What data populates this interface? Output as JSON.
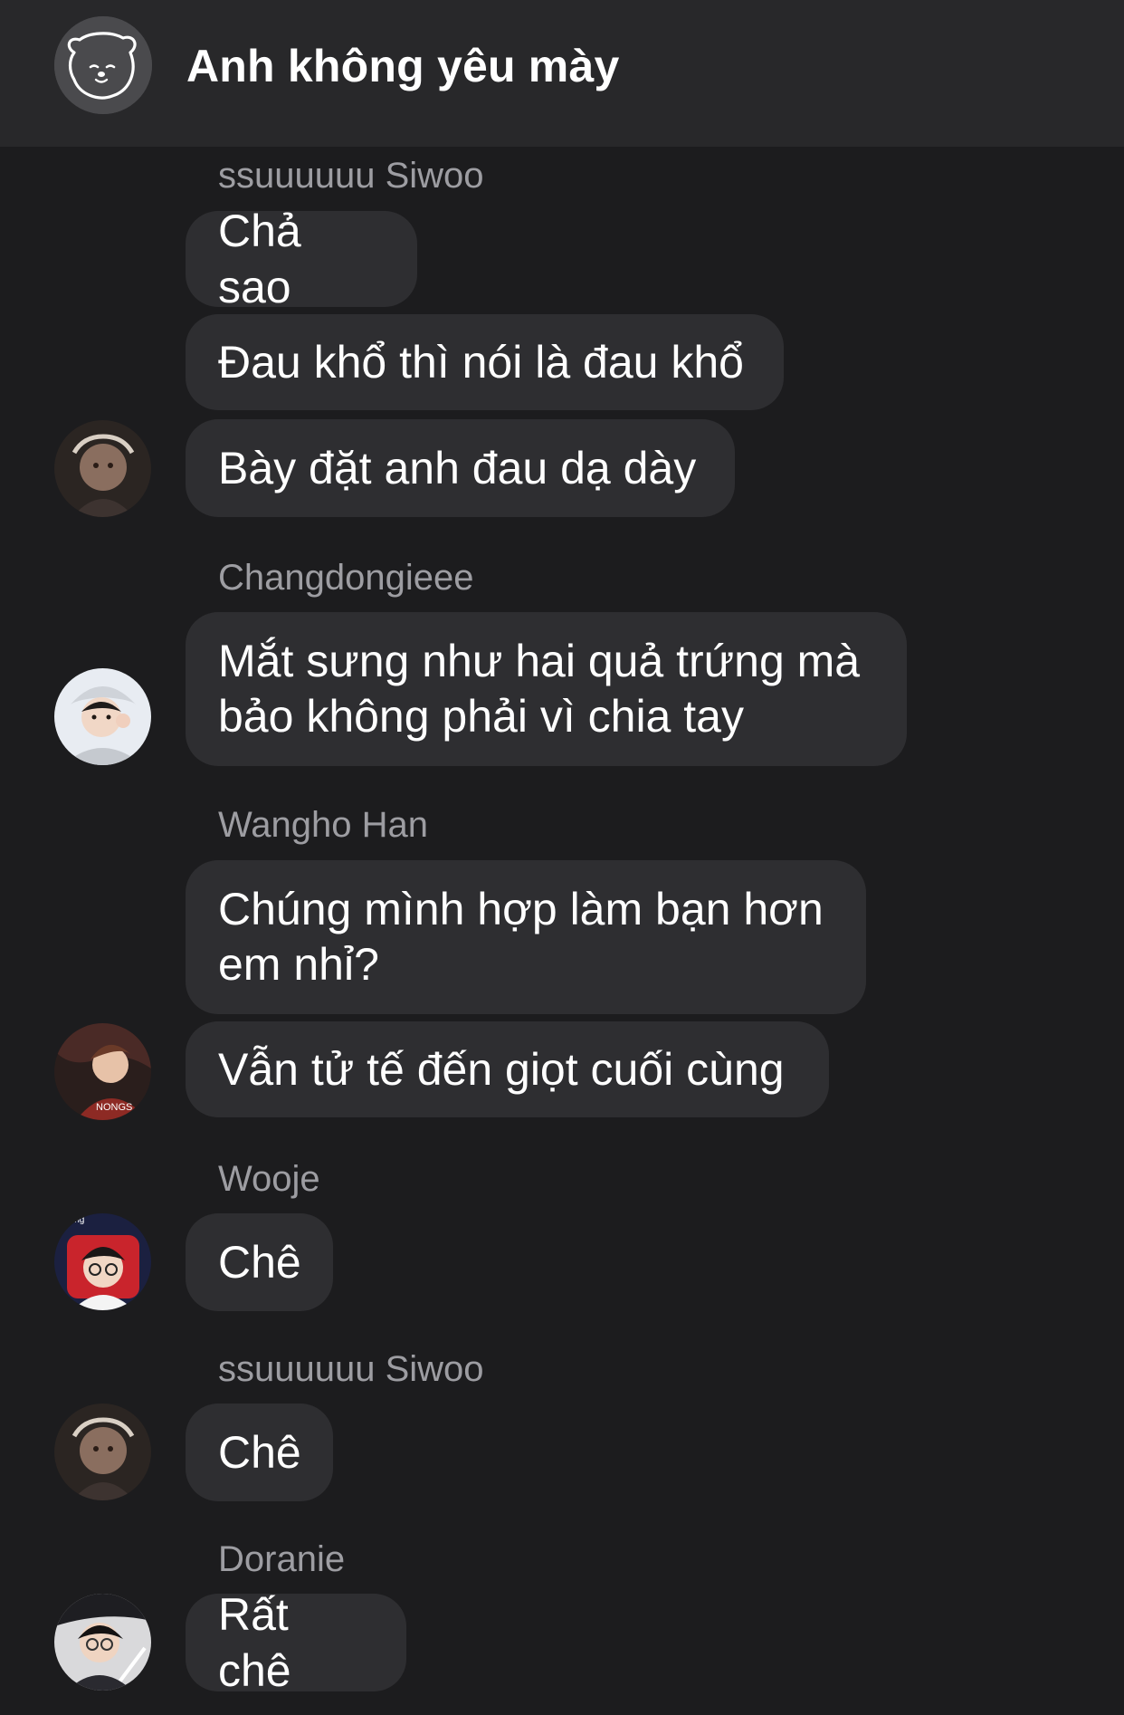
{
  "conversation": {
    "title": "Anh không yêu mày"
  },
  "messages": [
    {
      "sender": "ssuuuuuu Siwoo",
      "texts": [
        "Chả sao",
        "Đau khổ thì nói là đau khổ",
        "Bày đặt anh đau dạ dày"
      ]
    },
    {
      "sender": "Changdongieee",
      "texts": [
        "Mắt sưng như hai quả trứng mà bảo không phải vì chia tay"
      ]
    },
    {
      "sender": "Wangho Han",
      "texts": [
        "Chúng mình hợp làm bạn hơn em nhỉ?",
        "Vẫn tử tế đến giọt cuối cùng"
      ]
    },
    {
      "sender": "Wooje",
      "texts": [
        "Chê"
      ]
    },
    {
      "sender": "ssuuuuuu Siwoo",
      "texts": [
        "Chê"
      ]
    },
    {
      "sender": "Doranie",
      "texts": [
        "Rất chê"
      ]
    }
  ],
  "avatars": {
    "wooje_badge_text": "ing",
    "wangho_shirt_text": "NONGS"
  }
}
